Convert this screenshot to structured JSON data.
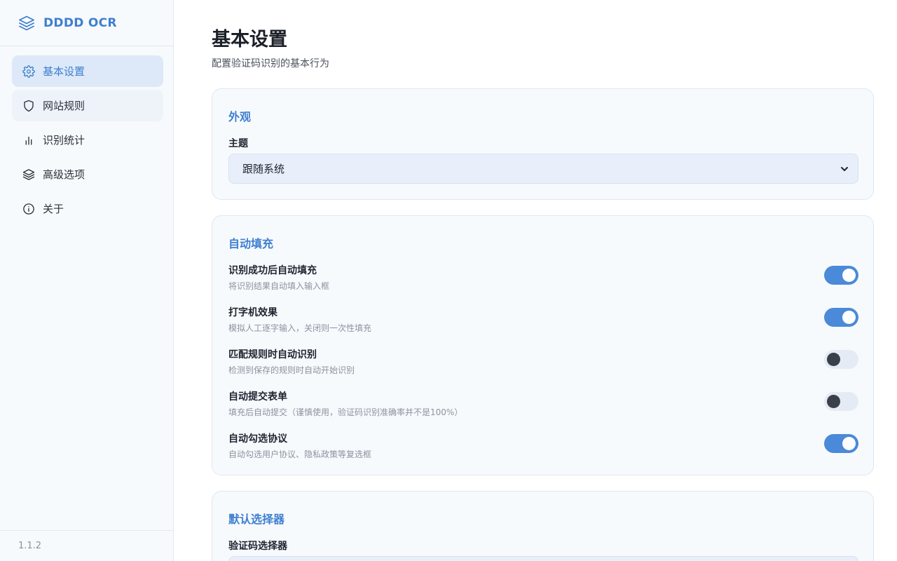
{
  "app": {
    "name": "DDDD OCR",
    "version": "1.1.2"
  },
  "sidebar": {
    "items": [
      {
        "label": "基本设置",
        "icon": "gear-icon"
      },
      {
        "label": "网站规则",
        "icon": "shield-icon"
      },
      {
        "label": "识别统计",
        "icon": "bar-chart-icon"
      },
      {
        "label": "高级选项",
        "icon": "layers-icon"
      },
      {
        "label": "关于",
        "icon": "info-icon"
      }
    ],
    "active_index": 0
  },
  "page": {
    "title": "基本设置",
    "subtitle": "配置验证码识别的基本行为"
  },
  "appearance": {
    "title": "外观",
    "theme_label": "主题",
    "theme_value": "跟随系统"
  },
  "autofill": {
    "title": "自动填充",
    "settings": [
      {
        "label": "识别成功后自动填充",
        "desc": "将识别结果自动填入输入框",
        "enabled": true
      },
      {
        "label": "打字机效果",
        "desc": "模拟人工逐字输入，关闭则一次性填充",
        "enabled": true
      },
      {
        "label": "匹配规则时自动识别",
        "desc": "检测到保存的规则时自动开始识别",
        "enabled": false
      },
      {
        "label": "自动提交表单",
        "desc": "填充后自动提交（谨慎使用，验证码识别准确率并不是100%）",
        "enabled": false
      },
      {
        "label": "自动勾选协议",
        "desc": "自动勾选用户协议、隐私政策等复选框",
        "enabled": true
      }
    ]
  },
  "selector": {
    "title": "默认选择器",
    "captcha_selector_label": "验证码选择器"
  },
  "colors": {
    "accent": "#3e7fd0",
    "toggle_on": "#4a8ad8",
    "card_bg": "#f7fafd"
  }
}
